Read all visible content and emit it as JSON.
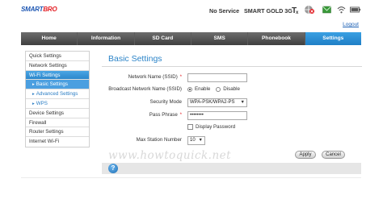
{
  "brand": {
    "logo_left": "SMART",
    "logo_right": "BRO"
  },
  "status": {
    "service": "No Service",
    "operator": "SMART GOLD 3G",
    "icons": [
      "no-signal-tx-icon",
      "disconnected-globe-icon",
      "sms-envelope-icon",
      "wifi-icon",
      "battery-icon"
    ]
  },
  "header": {
    "logout_label": "Logout"
  },
  "nav": {
    "tabs": [
      {
        "label": "Home"
      },
      {
        "label": "Information"
      },
      {
        "label": "SD Card"
      },
      {
        "label": "SMS"
      },
      {
        "label": "Phonebook"
      },
      {
        "label": "Settings"
      }
    ],
    "active": "Settings"
  },
  "sidebar": {
    "items": [
      {
        "label": "Quick Settings"
      },
      {
        "label": "Network Settings"
      },
      {
        "label": "Wi-Fi Settings"
      },
      {
        "label": "Basic Settings"
      },
      {
        "label": "Advanced Settings"
      },
      {
        "label": "WPS"
      },
      {
        "label": "Device Settings"
      },
      {
        "label": "Firewall"
      },
      {
        "label": "Router Settings"
      },
      {
        "label": "Internet Wi-Fi"
      }
    ]
  },
  "main": {
    "title": "Basic Settings",
    "form": {
      "ssid_label": "Network Name (SSID)",
      "ssid_value": "",
      "broadcast_label": "Broadcast Network Name (SSID)",
      "broadcast_enable": "Enable",
      "broadcast_disable": "Disable",
      "broadcast_selected": "Enable",
      "security_label": "Security Mode",
      "security_value": "WPA-PSK/WPA2-PS",
      "passphrase_label": "Pass Phrase",
      "passphrase_value": "••••••••",
      "display_password_label": "Display Password",
      "max_station_label": "Max Station Number",
      "max_station_value": "10",
      "required_mark": "*"
    },
    "buttons": {
      "apply": "Apply",
      "cancel": "Cancel"
    },
    "help_icon_text": "?"
  },
  "watermark": "www.howtoquick.net",
  "colors": {
    "accent": "#2c84c8",
    "nav_bg": "#4f4f4f",
    "nav_active": "#2a8bd2",
    "required": "#e31e24"
  }
}
